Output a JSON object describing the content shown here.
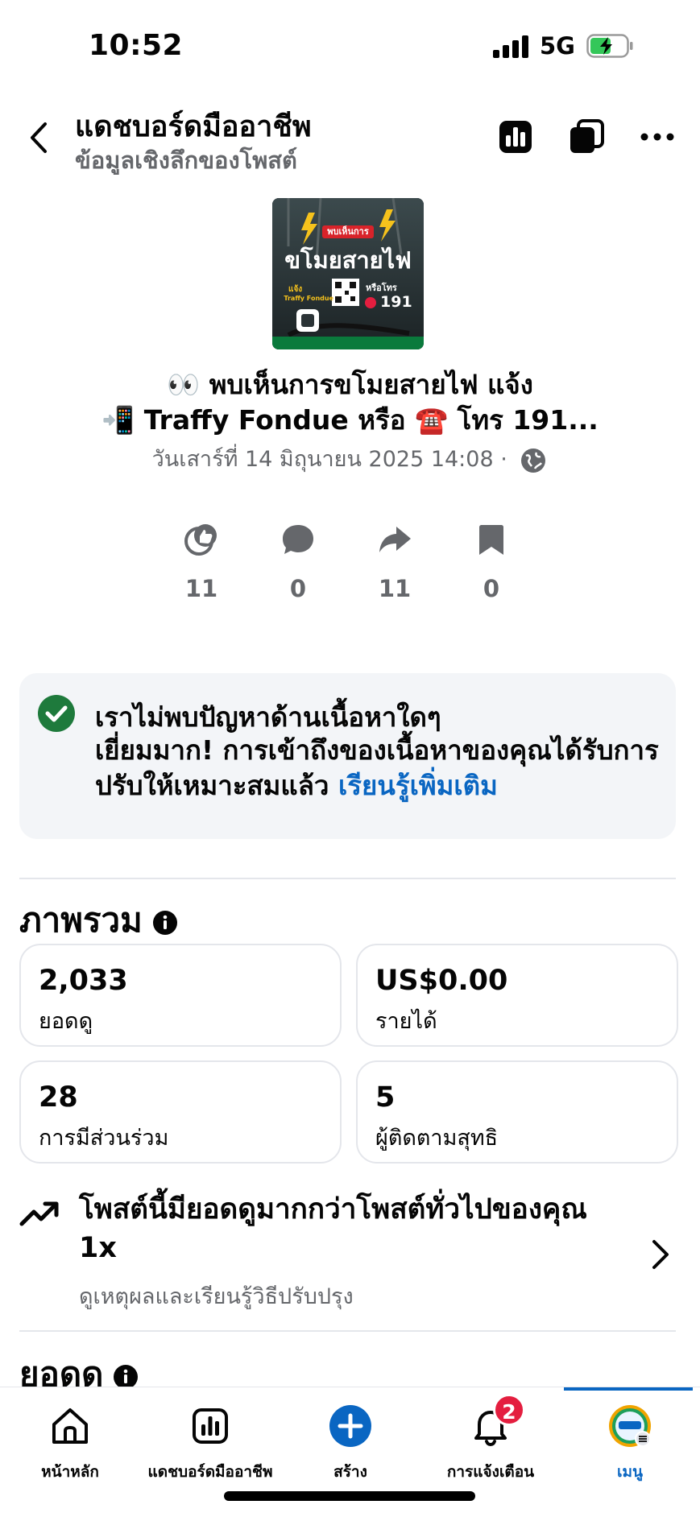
{
  "status": {
    "time": "10:52",
    "network": "5G"
  },
  "header": {
    "title": "แดชบอร์ดมืออาชีพ",
    "subtitle": "ข้อมูลเชิงลึกของโพสต์"
  },
  "post": {
    "thumbnail_text": {
      "top": "พบเห็นการ",
      "main": "ขโมยสายไฟ",
      "report_via": "แจ้ง",
      "app": "Traffy Fondue",
      "or_call": "หรือโทร",
      "phone": "191"
    },
    "text_line1": "👀 พบเห็นการขโมยสายไฟ แจ้ง",
    "text_line2": "📲 Traffy Fondue หรือ ☎️ โทร 191...",
    "date": "วันเสาร์ที่ 14 มิถุนายน  2025 14:08 ·"
  },
  "reactions": {
    "likes": "11",
    "comments": "0",
    "shares": "11",
    "saves": "0"
  },
  "notice": {
    "title": "เราไม่พบปัญหาด้านเนื้อหาใดๆ",
    "body": "เยี่ยมมาก! การเข้าถึงของเนื้อหาของคุณได้รับการปรับให้เหมาะสมแล้ว",
    "link": "เรียนรู้เพิ่มเติม"
  },
  "overview": {
    "title": "ภาพรวม",
    "cards": [
      {
        "value": "2,033",
        "label": "ยอดดู"
      },
      {
        "value": "US$0.00",
        "label": "รายได้"
      },
      {
        "value": "28",
        "label": "การมีส่วนร่วม"
      },
      {
        "value": "5",
        "label": "ผู้ติดตามสุทธิ"
      }
    ]
  },
  "insight": {
    "title": "โพสต์นี้มียอดดูมากกว่าโพสต์ทั่วไปของคุณ 1x",
    "subtitle": "ดูเหตุผลและเรียนรู้วิธีปรับปรุง"
  },
  "views_section": {
    "title": "ยอดดู"
  },
  "tabbar": {
    "home": "หน้าหลัก",
    "dashboard": "แดชบอร์ดมืออาชีพ",
    "create": "สร้าง",
    "notifications": "การแจ้งเตือน",
    "notifications_badge": "2",
    "menu": "เมนู"
  },
  "colors": {
    "accent": "#0a66c2",
    "success": "#1e7a3c",
    "badge": "#e41e3f",
    "muted_text": "#65676b"
  }
}
